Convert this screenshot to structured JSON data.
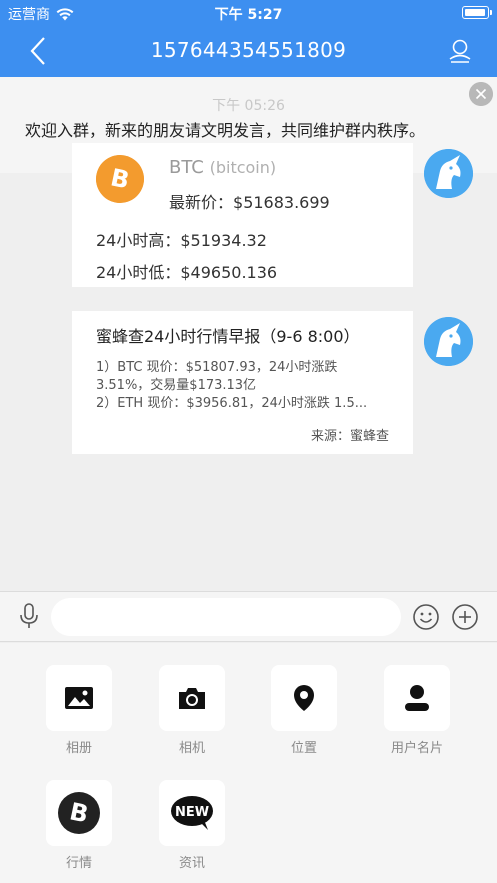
{
  "status_bar": {
    "carrier": "运营商",
    "time": "下午 5:27"
  },
  "nav": {
    "title": "157644354551809"
  },
  "notice": {
    "time": "下午 05:26",
    "text": "欢迎入群，新来的朋友请文明发言，共同维护群内秩序。"
  },
  "coin_card": {
    "symbol": "BTC",
    "name": "(bitcoin)",
    "latest_label": "最新价：",
    "latest_value": "$51683.699",
    "high_label": "24小时高：",
    "high_value": "$51934.32",
    "low_label": "24小时低：",
    "low_value": "$49650.136",
    "logo_color": "#f39b2e"
  },
  "news_card": {
    "title": "蜜蜂查24小时行情早报（9-6 8:00）",
    "lines": [
      "1）BTC 现价：$51807.93，24小时涨跌",
      "3.51%，交易量$173.13亿",
      "2）ETH 现价：$3956.81，24小时涨跌 1.5..."
    ],
    "source": "来源：蜜蜂查"
  },
  "input": {
    "placeholder": ""
  },
  "tools": [
    {
      "label": "相册",
      "icon": "photo-icon"
    },
    {
      "label": "相机",
      "icon": "camera-icon"
    },
    {
      "label": "位置",
      "icon": "location-icon"
    },
    {
      "label": "用户名片",
      "icon": "user-card-icon"
    },
    {
      "label": "行情",
      "icon": "bitcoin-icon"
    },
    {
      "label": "资讯",
      "icon": "news-icon"
    }
  ],
  "colors": {
    "accent": "#3d8ff0",
    "avatar": "#4aa9f0"
  }
}
